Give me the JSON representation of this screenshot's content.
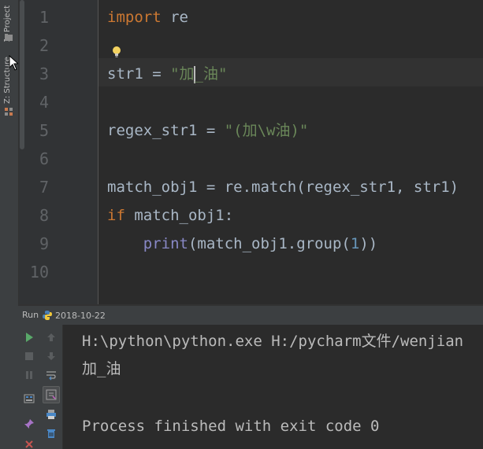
{
  "tool_window_tabs": {
    "project": "1: Project",
    "structure": "Z: Structure"
  },
  "editor": {
    "line_numbers": [
      "1",
      "2",
      "3",
      "4",
      "5",
      "6",
      "7",
      "8",
      "9",
      "10"
    ],
    "lines": {
      "l1": {
        "kw": "import",
        "rest": " re"
      },
      "l3": {
        "name": "str1",
        "op": " = ",
        "str": "\"加_油\"",
        "str_before_caret": "\"加",
        "str_after_caret": "_油\""
      },
      "l5": {
        "name": "regex_str1",
        "op": " = ",
        "str": "\"(加\\w油)\""
      },
      "l7": {
        "text": "match_obj1 = re.match(regex_str1, str1)"
      },
      "l8": {
        "kw": "if",
        "rest": " match_obj1:"
      },
      "l9": {
        "indent": "    ",
        "builtin": "print",
        "before_num": "(match_obj1.group(",
        "num": "1",
        "after_num": "))"
      }
    },
    "caret_line": 3
  },
  "run_panel": {
    "label": "Run",
    "config_name": "2018-10-22",
    "console_lines": [
      "H:\\python\\python.exe H:/pycharm文件/wenjian",
      "加_油",
      "",
      "Process finished with exit code 0"
    ]
  },
  "colors": {
    "keyword": "#cc7832",
    "string": "#6a8759",
    "builtin": "#8888c6",
    "number": "#6897bb",
    "text": "#a9b7c6",
    "run_green": "#59a869"
  },
  "icons": {
    "run": "play-icon",
    "stop": "stop-icon",
    "pause": "pause-icon",
    "up": "arrow-up-icon",
    "down": "arrow-down-icon",
    "softwrap": "soft-wrap-icon",
    "scroll_end": "scroll-to-end-icon",
    "print": "print-icon",
    "trash": "trash-icon",
    "pin": "pin-icon",
    "close": "close-icon",
    "layout": "layout-icon",
    "bulb": "lightbulb-icon",
    "python": "python-icon"
  }
}
